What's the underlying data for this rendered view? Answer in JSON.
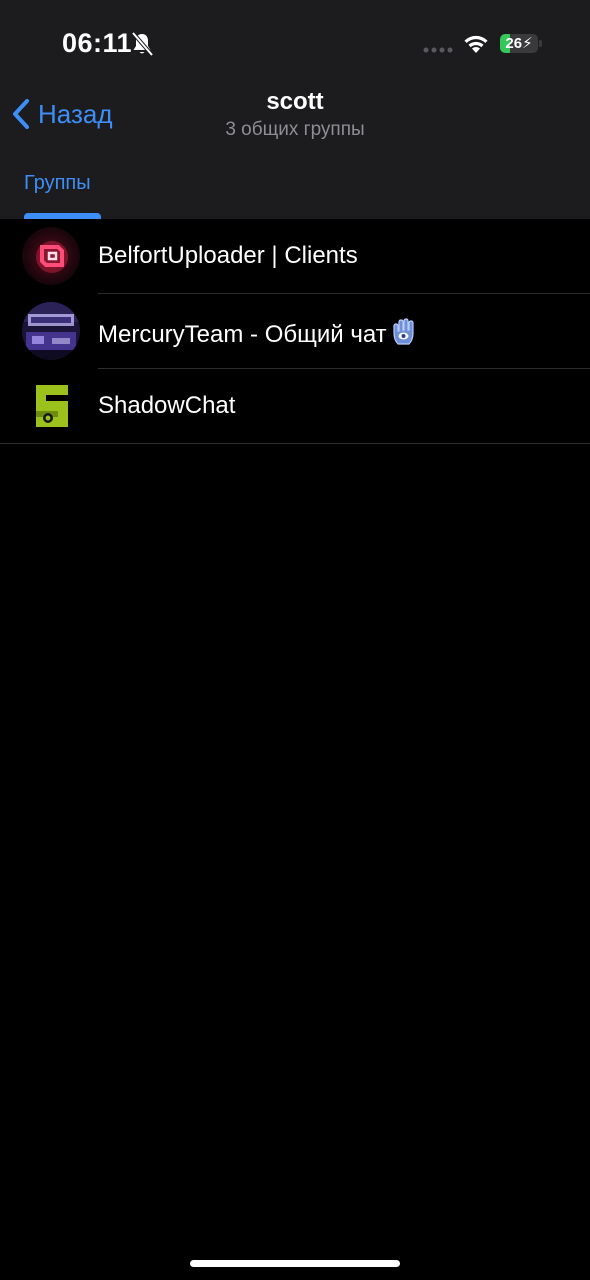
{
  "status_bar": {
    "time": "06:11",
    "battery_level": "26",
    "battery_percent_value": 26,
    "icons": [
      "bell-slash-icon",
      "cellular-dots-icon",
      "wifi-icon",
      "battery-charging-icon"
    ]
  },
  "nav": {
    "back_label": "Назад",
    "title": "scott",
    "subtitle": "3 общих группы"
  },
  "tabs": [
    {
      "label": "Группы",
      "active": true
    }
  ],
  "groups": [
    {
      "name": "BelfortUploader | Clients",
      "avatar": "belfort-logo"
    },
    {
      "name": "MercuryTeam - Общий чат",
      "avatar": "mercury-logo",
      "emoji": "hamsa-icon"
    },
    {
      "name": "ShadowChat",
      "avatar": "shadowchat-logo"
    }
  ],
  "colors": {
    "accent": "#3e8ef7",
    "header_bg": "#1c1c1e",
    "background": "#000000",
    "secondary_text": "#8e8e93",
    "battery_green": "#34c759"
  }
}
